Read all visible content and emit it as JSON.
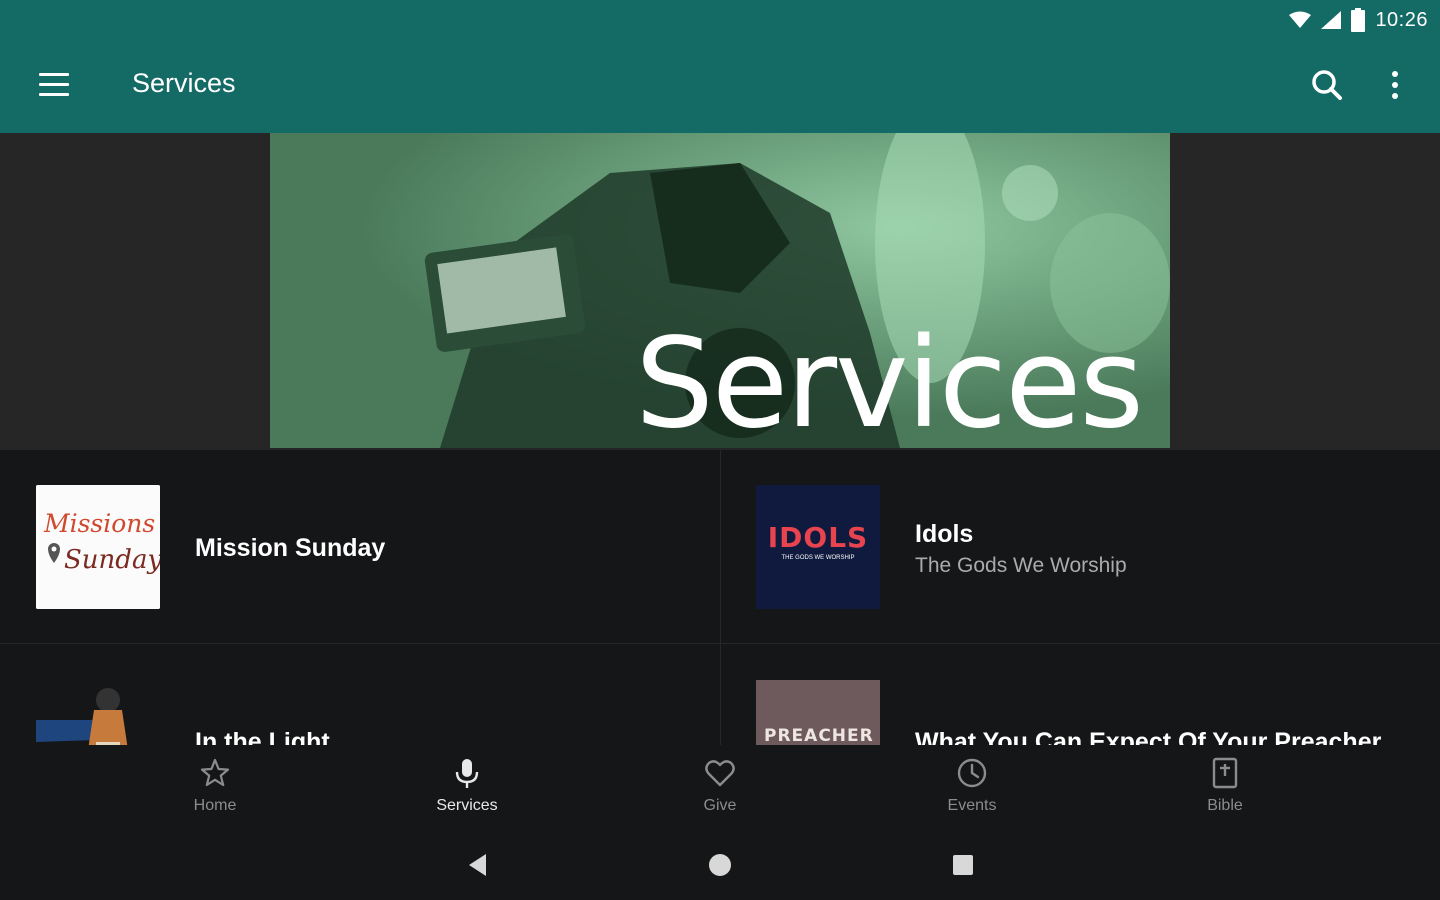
{
  "status_bar": {
    "time": "10:26",
    "icons": [
      "wifi-icon",
      "signal-icon",
      "battery-icon"
    ]
  },
  "app_bar": {
    "title": "Services",
    "menu_icon": "hamburger-menu-icon",
    "search_icon": "search-icon",
    "more_icon": "more-vertical-icon"
  },
  "hero": {
    "text": "Services"
  },
  "series": [
    {
      "title": "Mission Sunday",
      "subtitle": "",
      "thumb_text_1": "Missions",
      "thumb_text_2": "Sunday"
    },
    {
      "title": "Idols",
      "subtitle": "The Gods We Worship",
      "thumb_text_1": "IDOLS",
      "thumb_text_2": "THE GODS WE WORSHIP"
    },
    {
      "title": "In the Light",
      "subtitle": ""
    },
    {
      "title": "What You Can Expect Of Your Preacher",
      "subtitle": "",
      "thumb_text_1": "PREACHER"
    }
  ],
  "bottom_nav": [
    {
      "label": "Home",
      "icon": "star-icon",
      "active": false
    },
    {
      "label": "Services",
      "icon": "microphone-icon",
      "active": true
    },
    {
      "label": "Give",
      "icon": "heart-icon",
      "active": false
    },
    {
      "label": "Events",
      "icon": "clock-icon",
      "active": false
    },
    {
      "label": "Bible",
      "icon": "bible-icon",
      "active": false
    }
  ],
  "system_nav": [
    "back-icon",
    "home-icon",
    "recents-icon"
  ],
  "colors": {
    "app_bar": "#146b66",
    "background": "#151618",
    "hero_tint": "#4a7a5a",
    "text_secondary": "#a9abad"
  }
}
